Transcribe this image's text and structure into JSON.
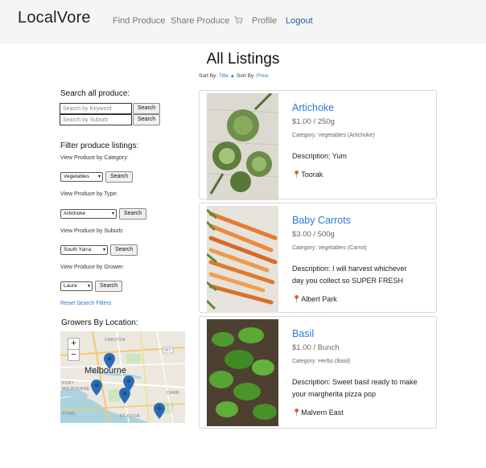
{
  "nav": {
    "brand": "LocalVore",
    "find": "Find Produce",
    "share": "Share Produce",
    "cart_icon": "cart-icon",
    "profile": "Profile",
    "logout": "Logout"
  },
  "page": {
    "title": "All Listings",
    "sort_by_1": "Sort By:",
    "sort_title": "Title ▲",
    "sort_by_2": "Sort By:",
    "sort_price": "Price"
  },
  "sidebar": {
    "search_heading": "Search all produce:",
    "keyword_placeholder": "Search by Keyword",
    "suburb_placeholder": "Search by Suburb",
    "search_button": "Search",
    "filter_heading": "Filter produce listings:",
    "filters": [
      {
        "label": "View Produce by Category:",
        "selected": "Vegetables",
        "button": "Search"
      },
      {
        "label": "View Produce by Type:",
        "selected": "Artichoke",
        "button": "Search"
      },
      {
        "label": "View Produce by Suburb:",
        "selected": "South Yarra",
        "button": "Search"
      },
      {
        "label": "View Produce by Grower:",
        "selected": "Laura",
        "button": "Search"
      }
    ],
    "reset": "Reset Search Filters",
    "map_heading": "Growers By Location:",
    "map": {
      "zoom_in": "+",
      "zoom_out": "−",
      "city": "Melbourne",
      "labels": [
        "CARLTON",
        "NORTH",
        "PORT",
        "MELBOURNE",
        "CAMB",
        "TOWN",
        "ST KILDA",
        "M3"
      ]
    }
  },
  "listings": [
    {
      "title": "Artichoke",
      "price": "$1.00 / 250g",
      "category": "Category: Vegetables (Artichoke)",
      "desc_lines": [
        "Description: Yum"
      ],
      "location": "Toorak"
    },
    {
      "title": "Baby Carrots",
      "price": "$3.00 / 500g",
      "category": "Category: Vegetables (Carrot)",
      "desc_lines": [
        "Description: I will harvest whichever",
        "day you collect so SUPER FRESH"
      ],
      "location": "Albert Park"
    },
    {
      "title": "Basil",
      "price": "$1.00 / Bunch",
      "category": "Category: Herbs (Basil)",
      "desc_lines": [
        "Description: Sweet basil ready to make",
        "your margherita pizza pop"
      ],
      "location": "Malvern East"
    }
  ],
  "colors": {
    "link": "#2a7bd0",
    "navbar": "#f5f5f5",
    "pin": "#2a6db5"
  }
}
